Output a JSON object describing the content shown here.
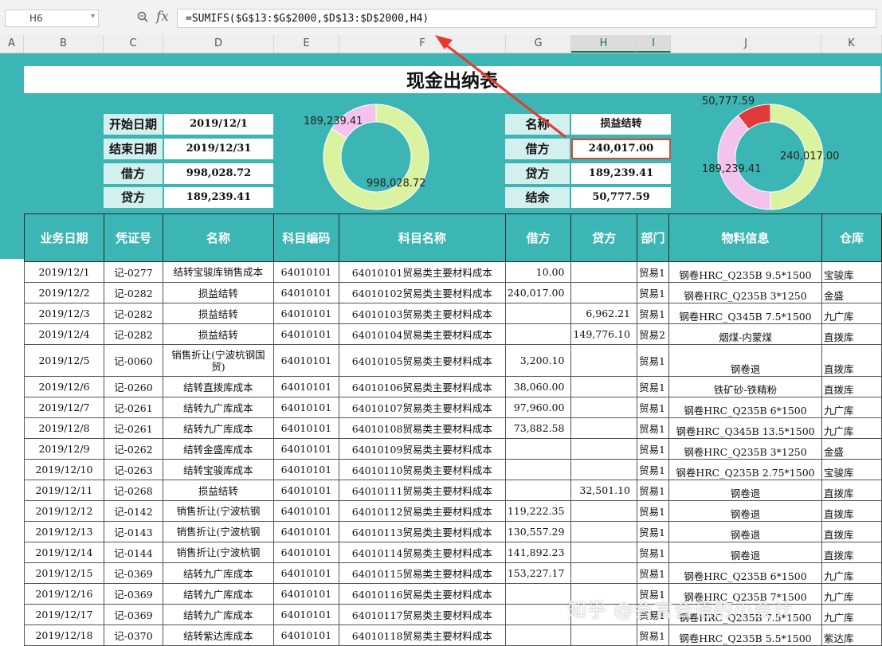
{
  "formula_bar": {
    "cell_ref": "H6",
    "fx_label": "fx",
    "formula": "=SUMIFS($G$13:$G$2000,$D$13:$D$2000,H4)"
  },
  "columns": [
    "A",
    "B",
    "C",
    "D",
    "E",
    "F",
    "G",
    "H",
    "I",
    "J",
    "K"
  ],
  "title": "现金出纳表",
  "summary_left": {
    "rows": [
      {
        "label": "开始日期",
        "value": "2019/12/1"
      },
      {
        "label": "结束日期",
        "value": "2019/12/31"
      },
      {
        "label": "借方",
        "value": "998,028.72"
      },
      {
        "label": "贷方",
        "value": "189,239.41"
      }
    ]
  },
  "summary_right": {
    "rows": [
      {
        "label": "名称",
        "value": "损益结转"
      },
      {
        "label": "借方",
        "value": "240,017.00"
      },
      {
        "label": "贷方",
        "value": "189,239.41"
      },
      {
        "label": "结余",
        "value": "50,777.59"
      }
    ]
  },
  "chart_data": [
    {
      "type": "pie",
      "labels": [
        "998,028.72",
        "189,239.41"
      ],
      "values": [
        998028.72,
        189239.41
      ],
      "colors": [
        "#d9f3a0",
        "#f3c3ee"
      ]
    },
    {
      "type": "pie",
      "labels": [
        "240,017.00",
        "189,239.41",
        "50,777.59"
      ],
      "values": [
        240017.0,
        189239.41,
        50777.59
      ],
      "colors": [
        "#d9f3a0",
        "#f3c3ee",
        "#e23a3a"
      ]
    }
  ],
  "table": {
    "headers": [
      "业务日期",
      "凭证号",
      "名称",
      "科目编码",
      "科目名称",
      "借方",
      "贷方",
      "部门",
      "物料信息",
      "仓库"
    ],
    "rows": [
      [
        "2019/12/1",
        "记-0277",
        "结转宝骏库销售成本",
        "64010101",
        "64010101贸易类主要材料成本",
        "10.00",
        "",
        "贸易1",
        "钢卷HRC_Q235B 9.5*1500",
        "宝骏库"
      ],
      [
        "2019/12/2",
        "记-0282",
        "损益结转",
        "64010101",
        "64010102贸易类主要材料成本",
        "240,017.00",
        "",
        "贸易1",
        "钢卷HRC_Q235B 3*1250",
        "金盛"
      ],
      [
        "2019/12/3",
        "记-0282",
        "损益结转",
        "64010101",
        "64010103贸易类主要材料成本",
        "",
        "6,962.21",
        "贸易1",
        "钢卷HRC_Q345B 7.5*1500",
        "九广库"
      ],
      [
        "2019/12/4",
        "记-0282",
        "损益结转",
        "64010101",
        "64010104贸易类主要材料成本",
        "",
        "149,776.10",
        "贸易2",
        "烟煤-内蒙煤",
        "直拨库"
      ],
      [
        "2019/12/5",
        "记-0060",
        "销售折让(宁波杭钢国贸)",
        "64010101",
        "64010105贸易类主要材料成本",
        "3,200.10",
        "",
        "贸易1",
        "钢卷退",
        "直拨库"
      ],
      [
        "2019/12/6",
        "记-0260",
        "结转直拨库成本",
        "64010101",
        "64010106贸易类主要材料成本",
        "38,060.00",
        "",
        "贸易1",
        "铁矿砂-铁精粉",
        "直拨库"
      ],
      [
        "2019/12/7",
        "记-0261",
        "结转九广库成本",
        "64010101",
        "64010107贸易类主要材料成本",
        "97,960.00",
        "",
        "贸易1",
        "钢卷HRC_Q235B 6*1500",
        "九广库"
      ],
      [
        "2019/12/8",
        "记-0261",
        "结转九广库成本",
        "64010101",
        "64010108贸易类主要材料成本",
        "73,882.58",
        "",
        "贸易1",
        "钢卷HRC_Q345B 13.5*1500",
        "九广库"
      ],
      [
        "2019/12/9",
        "记-0262",
        "结转金盛库成本",
        "64010101",
        "64010109贸易类主要材料成本",
        "",
        "",
        "贸易1",
        "钢卷HRC_Q235B 3*1250",
        "金盛"
      ],
      [
        "2019/12/10",
        "记-0263",
        "结转宝骏库成本",
        "64010101",
        "64010110贸易类主要材料成本",
        "",
        "",
        "贸易1",
        "钢卷HRC_Q235B 2.75*1500",
        "宝骏库"
      ],
      [
        "2019/12/11",
        "记-0268",
        "损益结转",
        "64010101",
        "64010111贸易类主要材料成本",
        "",
        "32,501.10",
        "贸易1",
        "钢卷退",
        "直拨库"
      ],
      [
        "2019/12/12",
        "记-0142",
        "销售折让(宁波杭钢",
        "64010101",
        "64010112贸易类主要材料成本",
        "119,222.35",
        "",
        "贸易1",
        "钢卷退",
        "直拨库"
      ],
      [
        "2019/12/13",
        "记-0143",
        "销售折让(宁波杭钢",
        "64010101",
        "64010113贸易类主要材料成本",
        "130,557.29",
        "",
        "贸易1",
        "钢卷退",
        "直拨库"
      ],
      [
        "2019/12/14",
        "记-0144",
        "销售折让(宁波杭钢",
        "64010101",
        "64010114贸易类主要材料成本",
        "141,892.23",
        "",
        "贸易1",
        "钢卷退",
        "直拨库"
      ],
      [
        "2019/12/15",
        "记-0369",
        "结转九广库成本",
        "64010101",
        "64010115贸易类主要材料成本",
        "153,227.17",
        "",
        "贸易1",
        "钢卷HRC_Q235B 6*1500",
        "九广库"
      ],
      [
        "2019/12/16",
        "记-0369",
        "结转九广库成本",
        "64010101",
        "64010116贸易类主要材料成本",
        "",
        "",
        "贸易1",
        "钢卷HRC_Q235B 7*1500",
        "九广库"
      ],
      [
        "2019/12/17",
        "记-0369",
        "结转九广库成本",
        "64010101",
        "64010117贸易类主要材料成本",
        "",
        "",
        "贸易1",
        "钢卷HRC_Q235B 7.5*1500",
        "九广库"
      ],
      [
        "2019/12/18",
        "记-0370",
        "结转紫达库成本",
        "64010101",
        "64010118贸易类主要材料成本",
        "",
        "",
        "贸易1",
        "钢卷HRC_Q235B 5.5*1500",
        "紫达库"
      ]
    ]
  },
  "watermark": "知乎 @会言会语的小会计"
}
